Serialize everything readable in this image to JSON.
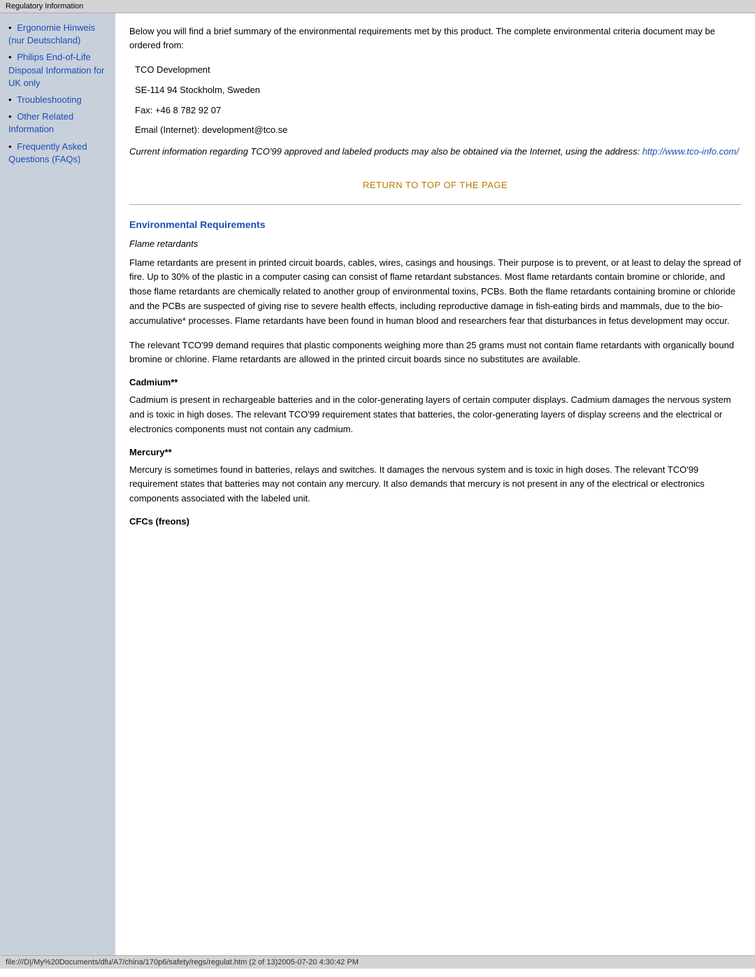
{
  "titleBar": {
    "text": "Regulatory Information"
  },
  "sidebar": {
    "items": [
      {
        "label": "Ergonomie Hinweis (nur Deutschland)",
        "href": "#ergonomie"
      },
      {
        "label": "Philips End-of-Life Disposal Information for UK only",
        "href": "#philips-disposal"
      },
      {
        "label": "Troubleshooting",
        "href": "#troubleshooting"
      },
      {
        "label": "Other Related Information",
        "href": "#other-related"
      },
      {
        "label": "Frequently Asked Questions (FAQs)",
        "href": "#faqs"
      }
    ]
  },
  "main": {
    "intro": "Below you will find a brief summary of the environmental requirements met by this product. The complete environmental criteria document may be ordered from:",
    "address": {
      "line1": "TCO Development",
      "line2": "SE-114 94 Stockholm, Sweden",
      "line3": "Fax: +46 8 782 92 07",
      "line4": "Email (Internet): development@tco.se"
    },
    "italicNote": "Current information regarding TCO'99 approved and labeled products may also be obtained via the Internet, using the address: ",
    "italicLink": "http://www.tco-info.com/",
    "returnToTop": "RETURN TO TOP OF THE PAGE",
    "sections": [
      {
        "heading": "Environmental Requirements",
        "subHeadingItalic": "Flame retardants",
        "paragraphs": [
          "Flame retardants are present in printed circuit boards, cables, wires, casings and housings. Their purpose is to prevent, or at least to delay the spread of fire. Up to 30% of the plastic in a computer casing can consist of flame retardant substances. Most flame retardants contain bromine or chloride, and those flame retardants are chemically related to another group of environmental toxins, PCBs. Both the flame retardants containing bromine or chloride and the PCBs are suspected of giving rise to severe health effects, including reproductive damage in fish-eating birds and mammals, due to the bio-accumulative* processes. Flame retardants have been found in human blood and researchers fear that disturbances in fetus development may occur.",
          "The relevant TCO'99 demand requires that plastic components weighing more than 25 grams must not contain flame retardants with organically bound bromine or chlorine. Flame retardants are allowed in the printed circuit boards since no substitutes are available."
        ],
        "subsections": [
          {
            "heading": "Cadmium**",
            "paragraph": "Cadmium is present in rechargeable batteries and in the color-generating layers of certain computer displays. Cadmium damages the nervous system and is toxic in high doses. The relevant TCO'99 requirement states that batteries, the color-generating layers of display screens and the electrical or electronics components must not contain any cadmium."
          },
          {
            "heading": "Mercury**",
            "paragraph": "Mercury is sometimes found in batteries, relays and switches. It damages the nervous system and is toxic in high doses. The relevant TCO'99 requirement states that batteries may not contain any mercury. It also demands that mercury is not present in any of the electrical or electronics components associated with the labeled unit."
          },
          {
            "heading": "CFCs (freons)",
            "paragraph": ""
          }
        ]
      }
    ]
  },
  "statusBar": {
    "text": "file:///D|/My%20Documents/dfu/A7/china/170p6/safety/regs/regulat.htm (2 of 13)2005-07-20 4:30:42 PM"
  }
}
